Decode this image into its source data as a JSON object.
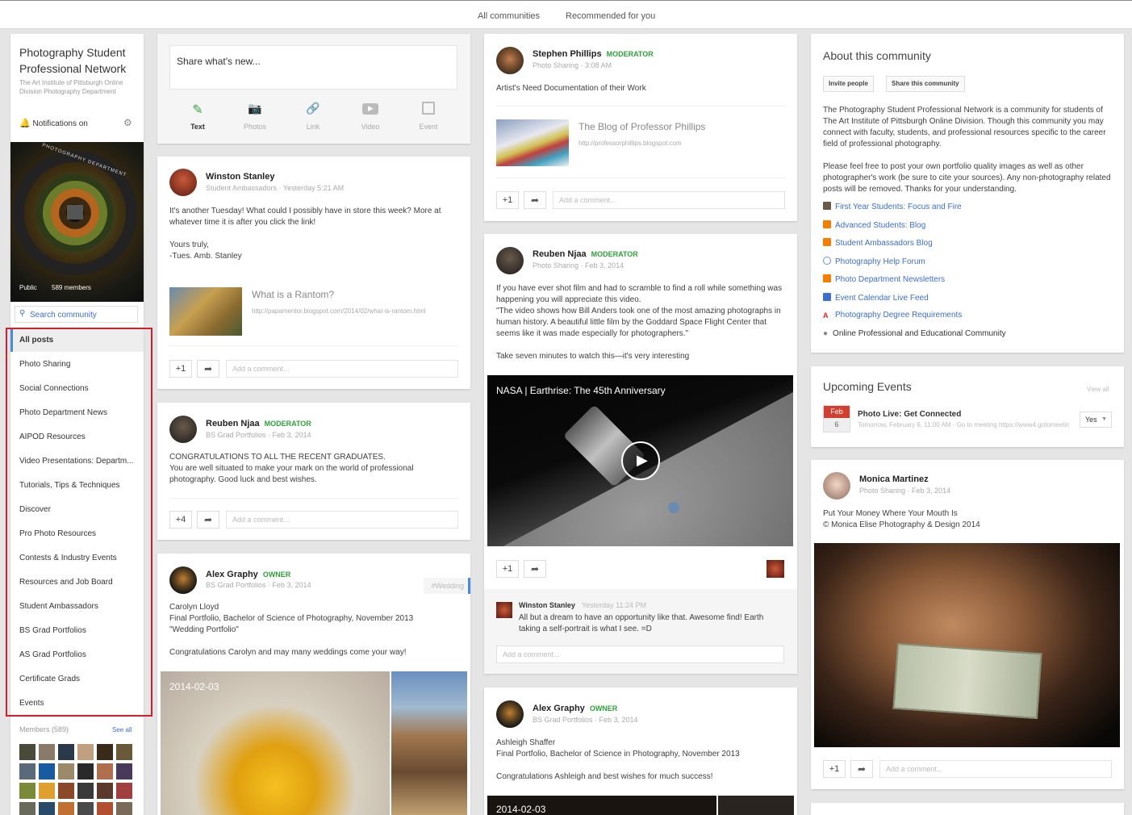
{
  "topnav": {
    "all_communities": "All communities",
    "recommended": "Recommended for you"
  },
  "community": {
    "title": "Photography Student Professional Network",
    "subtitle": "The Art Institute of Pittsburgh Online Division Photography Department",
    "notifications": "Notifications on",
    "cover_text": "PHOTOGRAPHY DEPARTMENT",
    "visibility": "Public",
    "members_count": "589 members",
    "search_placeholder": "Search community"
  },
  "categories": [
    "All posts",
    "Photo Sharing",
    "Social Connections",
    "Photo Department News",
    "AIPOD Resources",
    "Video Presentations: Departm...",
    "Tutorials, Tips & Techniques",
    "Discover",
    "Pro Photo Resources",
    "Contests & Industry Events",
    "Resources and Job Board",
    "Student Ambassadors",
    "BS Grad Portfolios",
    "AS Grad Portfolios",
    "Certificate Grads",
    "Events"
  ],
  "members": {
    "label": "Members (589)",
    "see_all": "See all"
  },
  "share_box": {
    "placeholder": "Share what's new...",
    "text": "Text",
    "photos": "Photos",
    "link": "Link",
    "video": "Video",
    "event": "Event"
  },
  "common": {
    "plus_one": "+1",
    "plus_four": "+4",
    "add_comment": "Add a comment..."
  },
  "post_winston": {
    "name": "Winston Stanley",
    "meta": "Student Ambassadors · Yesterday 5:21 AM",
    "line1": "It's another Tuesday! What could I possibly have in store this week? More at",
    "line2": "whatever time it is after you click the link!",
    "line3": "Yours truly,",
    "line4": "-Tues. Amb. Stanley",
    "link_title": "What is a Rantom?",
    "link_url": "http://papamentor.blogspot.com/2014/02/what-is-rantom.html"
  },
  "post_reuben_grad": {
    "name": "Reuben Njaa",
    "badge": "MODERATOR",
    "meta": "BS Grad Portfolios · Feb 3, 2014",
    "line1": "CONGRATULATIONS TO ALL THE RECENT GRADUATES.",
    "line2": "You are well situated to make your mark on the world of professional",
    "line3": "photography. Good luck and best wishes."
  },
  "post_alex_carolyn": {
    "name": "Alex Graphy",
    "badge": "OWNER",
    "meta": "BS Grad Portfolios · Feb 3, 2014",
    "tag": "#Wedding",
    "line1": "Carolyn Lloyd",
    "line2": "Final Portfolio, Bachelor of Science of Photography, November 2013",
    "line3": "\"Wedding Portfolio\"",
    "line4": "Congratulations Carolyn and may many weddings come your way!",
    "date_overlay": "2014-02-03"
  },
  "post_stephen": {
    "name": "Stephen Phillips",
    "badge": "MODERATOR",
    "meta": "Photo Sharing · 3:08 AM",
    "line1": "Artist's Need Documentation of their Work",
    "link_title": "The Blog of Professor Phillips",
    "link_url": "http://professorphillips.blogspot.com"
  },
  "post_reuben_video": {
    "name": "Reuben Njaa",
    "badge": "MODERATOR",
    "meta": "Photo Sharing · Feb 3, 2014",
    "line1": "If you have ever shot film and had to scramble to find a roll while something was",
    "line2": "happening you will appreciate this video.",
    "line3": "\"The video shows how Bill Anders took one of the most amazing photographs in",
    "line4": "human history. A beautiful little film by the Goddard Space Flight Center that",
    "line5": "seems like it was made especially for photographers.\"",
    "line6": "Take seven minutes to watch this—it's very interesting",
    "video_title": "NASA | Earthrise: The 45th Anniversary",
    "comment_name": "Winston Stanley",
    "comment_time": "Yesterday 11:24 PM",
    "comment_line1": "All but a dream to have an opportunity like that. Awesome find! Earth",
    "comment_line2": "taking a self-portrait is what I see. =D"
  },
  "post_alex_ashleigh": {
    "name": "Alex Graphy",
    "badge": "OWNER",
    "meta": "BS Grad Portfolios · Feb 3, 2014",
    "line1": "Ashleigh Shaffer",
    "line2": "Final Portfolio, Bachelor of Science in Photography, November 2013",
    "line3": "Congratulations Ashleigh and best wishes for much success!",
    "date_overlay": "2014-02-03"
  },
  "about": {
    "title": "About this community",
    "invite": "Invite people",
    "share": "Share this community",
    "p1_1": "The Photography Student Professional Network is a community for students of",
    "p1_2": "The Art Institute of Pittsburgh Online Division. Though this community you may",
    "p1_3": "connect with faculty, students, and professional resources specific to the career",
    "p1_4": "field of professional photography.",
    "p2_1": "Please feel free to post your own portfolio quality images as well as other",
    "p2_2": "photographer's work (be sure to cite your sources). Any non-photography related",
    "p2_3": "posts will be removed.  Thanks for your understanding.",
    "links": [
      {
        "label": "First Year Students: Focus and Fire",
        "icon": "photo-icon",
        "color": "#6a5a4a"
      },
      {
        "label": "Advanced Students: Blog",
        "icon": "blogger-icon",
        "color": "#f57d00"
      },
      {
        "label": "Student Ambassadors Blog",
        "icon": "blogger-icon",
        "color": "#f57d00"
      },
      {
        "label": "Photography Help Forum",
        "icon": "globe-icon",
        "color": "#6a8fd8"
      },
      {
        "label": "Photo Department Newsletters",
        "icon": "blogger-icon",
        "color": "#f57d00"
      },
      {
        "label": "Event Calendar Live Feed",
        "icon": "google-plus-icon",
        "color": "#3b6ecf"
      },
      {
        "label": "Photography Degree Requirements",
        "icon": "acrobat-icon",
        "color": "#d22"
      }
    ],
    "location": "Online Professional and Educational Community"
  },
  "events": {
    "title": "Upcoming Events",
    "view_all": "View all",
    "month": "Feb",
    "day": "6",
    "event_name": "Photo Live: Get Connected",
    "event_meta": "Tomorrow, February 6, 11:00 AM - Go to meeting https://www4.gotomeeting",
    "rsvp": "Yes"
  },
  "post_monica": {
    "name": "Monica Martinez",
    "meta": "Photo Sharing · Feb 3, 2014",
    "line1": "Put Your Money Where Your Mouth Is",
    "line2": "© Monica Elise Photography & Design 2014"
  }
}
